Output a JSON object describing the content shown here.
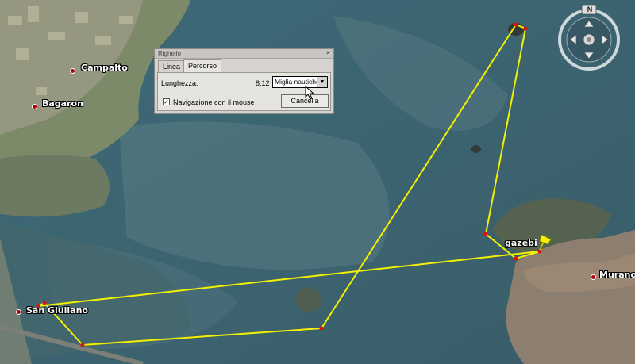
{
  "places": [
    {
      "name": "Campalto"
    },
    {
      "name": "Bagaron"
    },
    {
      "name": "San Giuliano"
    },
    {
      "name": "Murano"
    }
  ],
  "placemark": {
    "name": "gazebi"
  },
  "ruler": {
    "title": "Righello",
    "close": "×",
    "tabs": [
      "Linea",
      "Percorso"
    ],
    "active_tab": "Percorso",
    "length_label": "Lunghezza:",
    "length_value": "8,12",
    "unit_selected": "Miglia nautiche",
    "dropdown_arrow": "▼",
    "mouse_nav_checked": true,
    "check_mark": "✓",
    "mouse_nav_label": "Navigazione con il mouse",
    "cancel_label": "Cancella"
  },
  "nav_control": {
    "north_label": "N"
  },
  "colors": {
    "path": "#f3f000",
    "vertex": "#e01010",
    "water": "#4a6a73"
  }
}
